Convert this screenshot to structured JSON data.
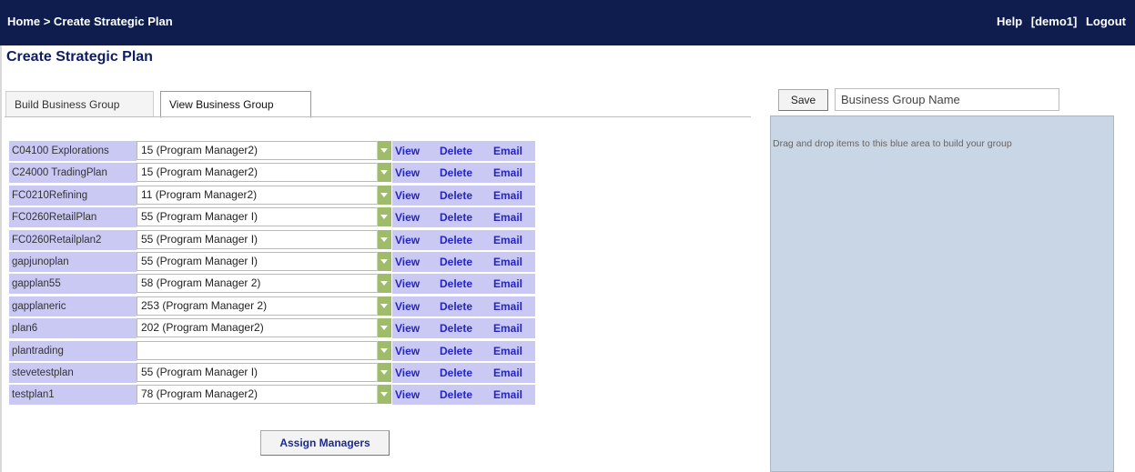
{
  "header": {
    "breadcrumb": "Home > Create Strategic Plan",
    "help": "Help",
    "user": "[demo1]",
    "logout": "Logout"
  },
  "page_title": "Create Strategic Plan",
  "tabs": [
    {
      "label": "Build Business Group",
      "active": false
    },
    {
      "label": "View Business Group",
      "active": true
    }
  ],
  "actions": {
    "view": "View",
    "delete": "Delete",
    "email": "Email"
  },
  "plans": [
    {
      "name": "C04100 Explorations",
      "manager": "15 (Program Manager2)"
    },
    {
      "name": "C24000 TradingPlan",
      "manager": "15 (Program Manager2)"
    },
    {
      "name": "FC0210Refining",
      "manager": "11 (Program Manager2)"
    },
    {
      "name": "FC0260RetailPlan",
      "manager": "55 (Program Manager I)"
    },
    {
      "name": "FC0260Retailplan2",
      "manager": "55 (Program Manager I)"
    },
    {
      "name": "gapjunoplan",
      "manager": "55 (Program Manager I)"
    },
    {
      "name": "gapplan55",
      "manager": "58 (Program Manager 2)"
    },
    {
      "name": "gapplaneric",
      "manager": "253 (Program Manager 2)"
    },
    {
      "name": "plan6",
      "manager": "202 (Program Manager2)"
    },
    {
      "name": "plantrading",
      "manager": ""
    },
    {
      "name": "stevetestplan",
      "manager": "55 (Program Manager I)"
    },
    {
      "name": "testplan1",
      "manager": "78 (Program Manager2)"
    }
  ],
  "assign_button": "Assign Managers",
  "right_panel": {
    "save_label": "Save",
    "group_name_value": "Business Group Name",
    "drop_hint": "Drag and drop items to this blue area to build your group"
  },
  "colors": {
    "header_bg": "#0e1d4e",
    "row_bg": "#c9c9f4",
    "link": "#2525c6",
    "dropdown_button": "#9ebc6a",
    "drop_area_bg": "#c9d6e5"
  },
  "icons": {
    "dropdown": "chevron-down-icon"
  }
}
